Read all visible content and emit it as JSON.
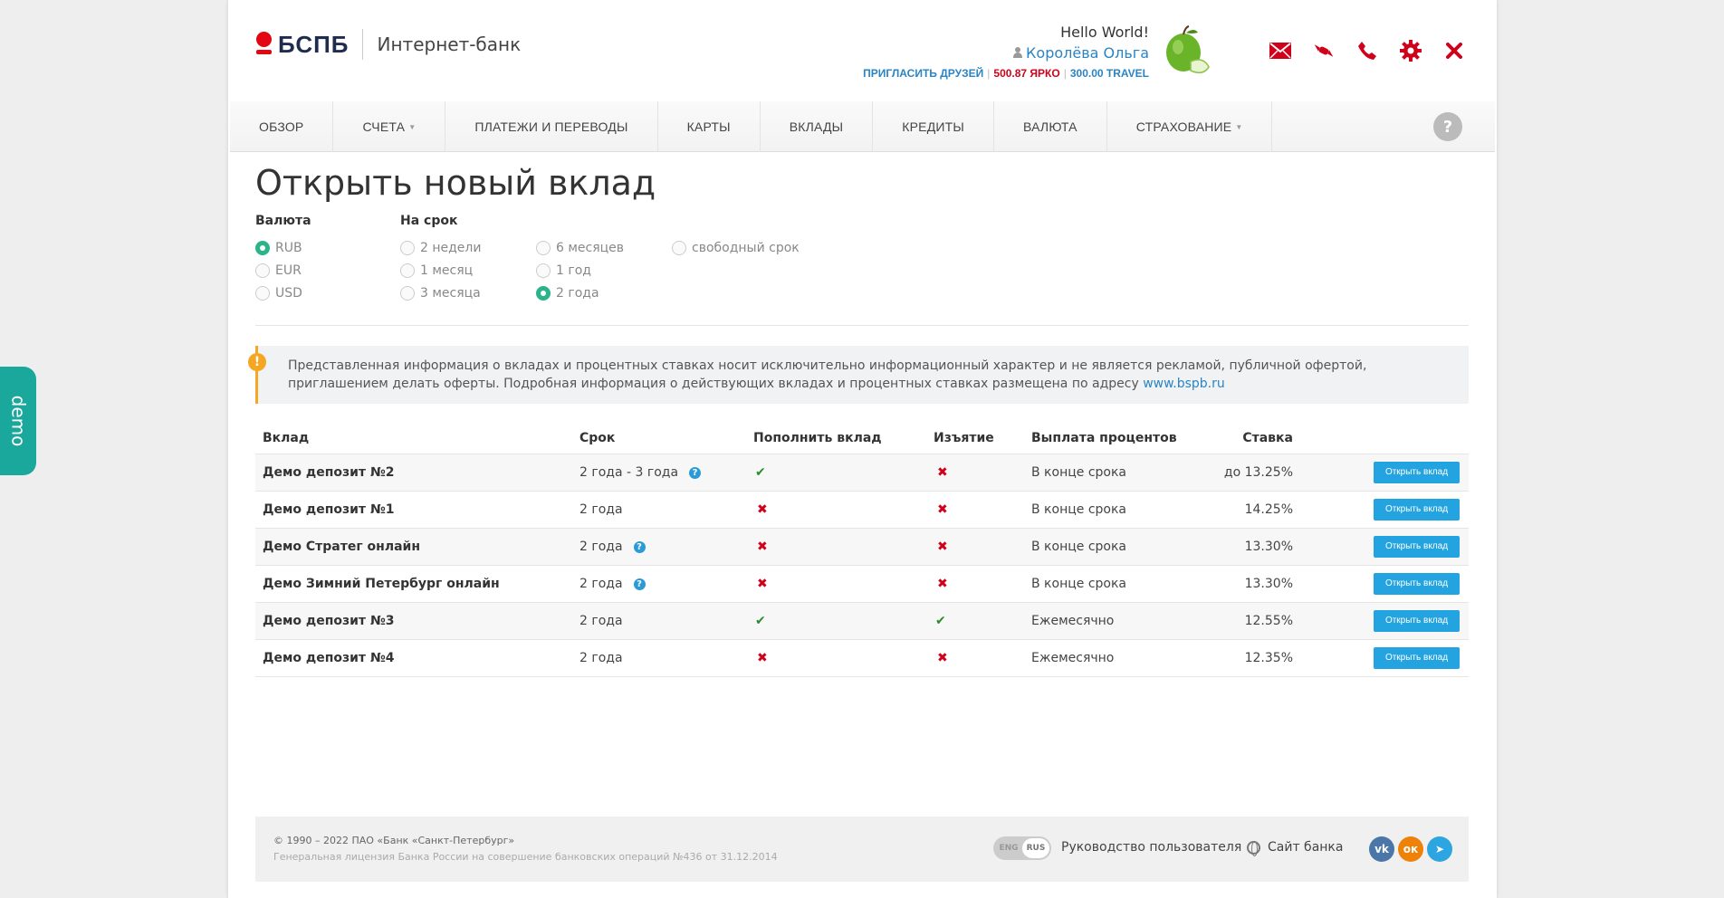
{
  "brand": {
    "name": "БСПБ",
    "subtitle": "Интернет-банк"
  },
  "user": {
    "greeting": "Hello World!",
    "name": "Королёва Ольга",
    "invite": "ПРИГЛАСИТЬ ДРУЗЕЙ",
    "bright_points": "500.87 ЯРКО",
    "travel_points": "300.00 TRAVEL"
  },
  "header_icons": [
    "mail-icon",
    "candy-icon",
    "phone-icon",
    "gear-icon",
    "close-icon"
  ],
  "nav": {
    "items": [
      {
        "label": "ОБЗОР"
      },
      {
        "label": "СЧЕТА",
        "dropdown": true
      },
      {
        "label": "ПЛАТЕЖИ И ПЕРЕВОДЫ"
      },
      {
        "label": "КАРТЫ"
      },
      {
        "label": "ВКЛАДЫ"
      },
      {
        "label": "КРЕДИТЫ"
      },
      {
        "label": "ВАЛЮТА"
      },
      {
        "label": "СТРАХОВАНИЕ",
        "dropdown": true
      }
    ],
    "help": "?"
  },
  "page_title": "Открыть новый вклад",
  "filters": {
    "currency_title": "Валюта",
    "currency": [
      {
        "label": "RUB",
        "checked": true
      },
      {
        "label": "EUR",
        "checked": false
      },
      {
        "label": "USD",
        "checked": false
      }
    ],
    "term_title": "На срок",
    "terms": [
      {
        "label": "2 недели",
        "checked": false
      },
      {
        "label": "1 месяц",
        "checked": false
      },
      {
        "label": "3 месяца",
        "checked": false
      },
      {
        "label": "6 месяцев",
        "checked": false
      },
      {
        "label": "1 год",
        "checked": false
      },
      {
        "label": "2 года",
        "checked": true
      },
      {
        "label": "свободный срок",
        "checked": false
      }
    ]
  },
  "notice": {
    "text": "Представленная информация о вкладах и процентных ставках носит исключительно информационный характер и не является рекламой, публичной офертой, приглашением делать оферты. Подробная информация о действующих вкладах и процентных ставках размещена по адресу ",
    "link": "www.bspb.ru"
  },
  "table": {
    "headers": [
      "Вклад",
      "Срок",
      "Пополнить вклад",
      "Изъятие",
      "Выплата процентов",
      "Ставка"
    ],
    "button_label": "Открыть вклад",
    "rows": [
      {
        "name": "Демо депозит №2",
        "term": "2 года - 3 года",
        "help": true,
        "topup": true,
        "withdraw": false,
        "payout": "В конце срока",
        "rate": "до 13.25%"
      },
      {
        "name": "Демо депозит №1",
        "term": "2 года",
        "help": false,
        "topup": false,
        "withdraw": false,
        "payout": "В конце срока",
        "rate": "14.25%"
      },
      {
        "name": "Демо Стратег онлайн",
        "term": "2 года",
        "help": true,
        "topup": false,
        "withdraw": false,
        "payout": "В конце срока",
        "rate": "13.30%"
      },
      {
        "name": "Демо Зимний Петербург онлайн",
        "term": "2 года",
        "help": true,
        "topup": false,
        "withdraw": false,
        "payout": "В конце срока",
        "rate": "13.30%"
      },
      {
        "name": "Демо депозит №3",
        "term": "2 года",
        "help": false,
        "topup": true,
        "withdraw": true,
        "payout": "Ежемесячно",
        "rate": "12.55%"
      },
      {
        "name": "Демо депозит №4",
        "term": "2 года",
        "help": false,
        "topup": false,
        "withdraw": false,
        "payout": "Ежемесячно",
        "rate": "12.35%"
      }
    ]
  },
  "footer": {
    "copyright": "© 1990 – 2022 ПАО «Банк «Санкт-Петербург»",
    "license": "Генеральная лицензия Банка России на совершение банковских операций №436 от 31.12.2014",
    "lang_eng": "ENG",
    "lang_rus": "RUS",
    "guide": "Руководство пользователя",
    "site": "Сайт банка",
    "socials": [
      {
        "icon": "vk-icon",
        "glyph": "vk",
        "color": "#4a76a8"
      },
      {
        "icon": "odnoklassniki-icon",
        "glyph": "ок",
        "color": "#ee8208"
      },
      {
        "icon": "telegram-icon",
        "glyph": "➤",
        "color": "#2ca5e0"
      }
    ]
  },
  "demo_tab": "demo",
  "colors": {
    "accent": "#2a84c4",
    "brand_red": "#e30613",
    "button": "#23a3e0",
    "demo": "#19a89b"
  }
}
